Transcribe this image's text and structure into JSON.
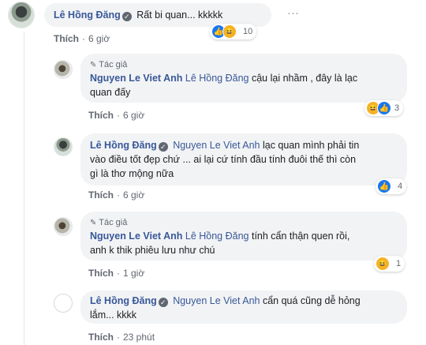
{
  "comments": [
    {
      "name": "Lê Hồng Đăng",
      "text": "Rất bi quan... kkkkk",
      "like_label": "Thích",
      "time": "6 giờ",
      "reaction_count": "10",
      "more": "···"
    },
    {
      "author_tag": "Tác giả",
      "name": "Nguyen Le Viet Anh",
      "mention": "Lê Hồng Đăng",
      "text_line1": "cậu lại nhầm , đây là lạc",
      "text_line2": "quan đấy",
      "like_label": "Thích",
      "time": "6 giờ",
      "reaction_count": "3"
    },
    {
      "name": "Lê Hồng Đăng",
      "mention": "Nguyen Le Viet Anh",
      "text_line1": "lạc quan mình phải tin",
      "text_line2": "vào điều tốt đẹp chứ ... ai lại cứ tính đầu tính đuôi thế thì còn",
      "text_line3": "gì là thơ mộng nữa",
      "like_label": "Thích",
      "time": "6 giờ",
      "reaction_count": "4"
    },
    {
      "author_tag": "Tác giả",
      "name": "Nguyen Le Viet Anh",
      "mention": "Lê Hồng Đăng",
      "text_line1": "tính cẩn thận quen rồi,",
      "text_line2": "anh k thik phiêu lưu như chú",
      "like_label": "Thích",
      "time": "1 giờ",
      "reaction_count": "1"
    },
    {
      "name": "Lê Hồng Đăng",
      "mention": "Nguyen Le Viet Anh",
      "text_line1": "cẩn quá cũng dễ hỏng",
      "text_line2": "lắm... kkkk",
      "like_label": "Thích",
      "time": "23 phút"
    }
  ],
  "icons": {
    "verified": "check-badge-icon",
    "like": "like-icon",
    "haha": "haha-icon",
    "pen": "pen-icon"
  },
  "colors": {
    "name": "#385898",
    "bubble": "#f2f3f5",
    "like": "#1877f2",
    "haha": "#f7b125"
  }
}
